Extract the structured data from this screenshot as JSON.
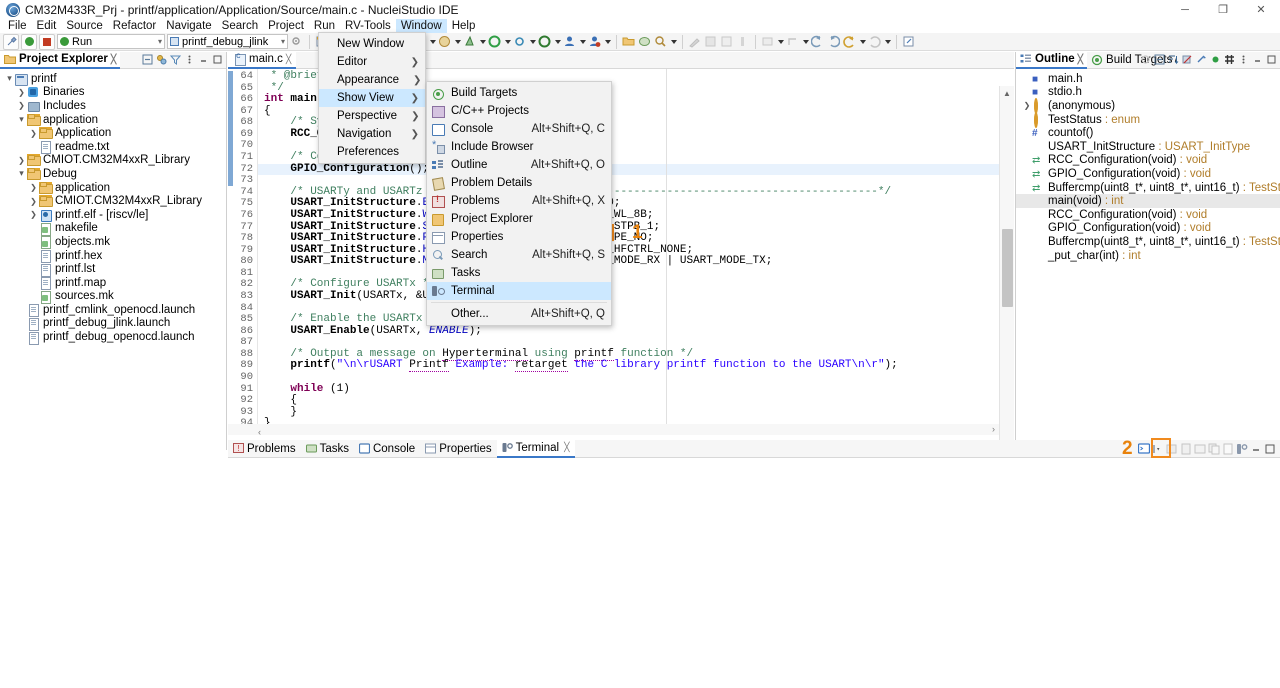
{
  "window": {
    "title": "CM32M433R_Prj - printf/application/Application/Source/main.c - NucleiStudio IDE",
    "minimize": "─",
    "maximize": "❐",
    "close": "✕"
  },
  "menubar": {
    "items": [
      {
        "label": "File"
      },
      {
        "label": "Edit"
      },
      {
        "label": "Source"
      },
      {
        "label": "Refactor"
      },
      {
        "label": "Navigate"
      },
      {
        "label": "Search"
      },
      {
        "label": "Project"
      },
      {
        "label": "Run"
      },
      {
        "label": "RV-Tools"
      },
      {
        "label": "Window",
        "active": true
      },
      {
        "label": "Help"
      }
    ]
  },
  "toolbar": {
    "run_config": "Run",
    "launch_config": "printf_debug_jlink"
  },
  "window_menu": {
    "items": [
      {
        "label": "New Window",
        "submenu": false
      },
      {
        "label": "Editor",
        "submenu": true
      },
      {
        "label": "Appearance",
        "submenu": true
      },
      {
        "label": "Show View",
        "submenu": true,
        "selected": true
      },
      {
        "label": "Perspective",
        "submenu": true
      },
      {
        "label": "Navigation",
        "submenu": true
      },
      {
        "label": "Preferences",
        "submenu": false
      }
    ]
  },
  "show_view_menu": {
    "items": [
      {
        "label": "Build Targets",
        "accel": "",
        "icon": "radio-icon"
      },
      {
        "label": "C/C++ Projects",
        "accel": "",
        "icon": "grid-icon"
      },
      {
        "label": "Console",
        "accel": "Alt+Shift+Q, C",
        "icon": "console-icon"
      },
      {
        "label": "Include Browser",
        "accel": "",
        "icon": "include-browser-icon"
      },
      {
        "label": "Outline",
        "accel": "Alt+Shift+Q, O",
        "icon": "outline-icon"
      },
      {
        "label": "Problem Details",
        "accel": "",
        "icon": "problem-details-icon"
      },
      {
        "label": "Problems",
        "accel": "Alt+Shift+Q, X",
        "icon": "problems-icon"
      },
      {
        "label": "Project Explorer",
        "accel": "",
        "icon": "project-explorer-icon"
      },
      {
        "label": "Properties",
        "accel": "",
        "icon": "properties-icon"
      },
      {
        "label": "Search",
        "accel": "Alt+Shift+Q, S",
        "icon": "search-icon"
      },
      {
        "label": "Tasks",
        "accel": "",
        "icon": "tasks-icon"
      },
      {
        "label": "Terminal",
        "accel": "",
        "icon": "terminal-icon",
        "selected": true,
        "highlighted": true
      },
      {
        "label": "Other...",
        "accel": "Alt+Shift+Q, Q",
        "icon": "",
        "divider_before": true
      }
    ]
  },
  "annotations": [
    {
      "number": "1"
    },
    {
      "number": "2"
    }
  ],
  "project_explorer": {
    "tab_label": "Project Explorer",
    "tree": [
      {
        "indent": 0,
        "arrow": "v",
        "icon": "project-icon",
        "label": "printf"
      },
      {
        "indent": 1,
        "arrow": ">",
        "icon": "binaries-icon",
        "label": "Binaries"
      },
      {
        "indent": 1,
        "arrow": ">",
        "icon": "includes-icon",
        "label": "Includes"
      },
      {
        "indent": 1,
        "arrow": "v",
        "icon": "folder-icon",
        "label": "application"
      },
      {
        "indent": 2,
        "arrow": ">",
        "icon": "folder-icon",
        "label": "Application"
      },
      {
        "indent": 2,
        "arrow": "",
        "icon": "file-icon",
        "label": "readme.txt"
      },
      {
        "indent": 1,
        "arrow": ">",
        "icon": "folder-icon",
        "label": "CMIOT.CM32M4xxR_Library"
      },
      {
        "indent": 1,
        "arrow": "v",
        "icon": "folder-icon",
        "label": "Debug"
      },
      {
        "indent": 2,
        "arrow": ">",
        "icon": "folder-icon",
        "label": "application"
      },
      {
        "indent": 2,
        "arrow": ">",
        "icon": "folder-icon",
        "label": "CMIOT.CM32M4xxR_Library"
      },
      {
        "indent": 2,
        "arrow": ">",
        "icon": "elf-icon",
        "label": "printf.elf - [riscv/le]"
      },
      {
        "indent": 2,
        "arrow": "",
        "icon": "makefile-icon",
        "label": "makefile"
      },
      {
        "indent": 2,
        "arrow": "",
        "icon": "makefile-icon",
        "label": "objects.mk"
      },
      {
        "indent": 2,
        "arrow": "",
        "icon": "file-icon",
        "label": "printf.hex"
      },
      {
        "indent": 2,
        "arrow": "",
        "icon": "file-icon",
        "label": "printf.lst"
      },
      {
        "indent": 2,
        "arrow": "",
        "icon": "file-icon",
        "label": "printf.map"
      },
      {
        "indent": 2,
        "arrow": "",
        "icon": "makefile-icon",
        "label": "sources.mk"
      },
      {
        "indent": 1,
        "arrow": "",
        "icon": "file-icon",
        "label": "printf_cmlink_openocd.launch"
      },
      {
        "indent": 1,
        "arrow": "",
        "icon": "file-icon",
        "label": "printf_debug_jlink.launch"
      },
      {
        "indent": 1,
        "arrow": "",
        "icon": "file-icon",
        "label": "printf_debug_openocd.launch"
      }
    ]
  },
  "editor": {
    "tab_label": "main.c",
    "first_line": 64,
    "lines": [
      {
        "n": 64,
        "html": "<span class='cmt'> * @brief Main program.</span>"
      },
      {
        "n": 65,
        "html": "<span class='cmt'> */</span>"
      },
      {
        "n": 66,
        "html": "<span class='kw'>int</span> <span style='font-weight:bold'>main</span>(<span class='kw'>void</span>)",
        "fold": true
      },
      {
        "n": 67,
        "html": "{"
      },
      {
        "n": 68,
        "html": "    <span class='cmt'>/* System Clocks Configuration */</span>"
      },
      {
        "n": 69,
        "html": "    <span style='font-weight:bold'>RCC_Configuration</span>();"
      },
      {
        "n": 70,
        "html": ""
      },
      {
        "n": 71,
        "html": "    <span class='cmt'>/* Configure the GPIO ports */</span>"
      },
      {
        "n": 72,
        "html": "    <span style='font-weight:bold'>GPIO_Configuration</span>();",
        "hl": true
      },
      {
        "n": 73,
        "html": ""
      },
      {
        "n": 74,
        "html": "    <span class='cmt'>/* USARTy and USARTz configuration ------------------------------------------------------*/</span>"
      },
      {
        "n": 75,
        "html": "    <span style='font-weight:bold'>USART_InitStructure</span>.<span class='fld'>BaudRate</span>             = 115200;"
      },
      {
        "n": 76,
        "html": "    <span style='font-weight:bold'>USART_InitStructure</span>.<span class='fld'>WordLength</span>           = USART_WL_8B;"
      },
      {
        "n": 77,
        "html": "    <span style='font-weight:bold'>USART_InitStructure</span>.<span class='fld'>StopBits</span>             = USART_STPB_1;"
      },
      {
        "n": 78,
        "html": "    <span style='font-weight:bold'>USART_InitStructure</span>.<span class='fld'>Parity</span>               = USART_PE_NO;"
      },
      {
        "n": 79,
        "html": "    <span style='font-weight:bold'>USART_InitStructure</span>.<span class='fld'>HardwareFlowControl</span>  = USART_HFCTRL_NONE;"
      },
      {
        "n": 80,
        "html": "    <span style='font-weight:bold'>USART_InitStructure</span>.<span class='fld'>Mode</span>                 = USART_MODE_RX | USART_MODE_TX;"
      },
      {
        "n": 81,
        "html": ""
      },
      {
        "n": 82,
        "html": "    <span class='cmt'>/* Configure USARTx */</span>"
      },
      {
        "n": 83,
        "html": "    <span style='font-weight:bold'>USART_Init</span>(USARTx, &amp;USART_InitStructure);"
      },
      {
        "n": 84,
        "html": ""
      },
      {
        "n": 85,
        "html": "    <span class='cmt'>/* Enable the USARTx */</span>"
      },
      {
        "n": 86,
        "html": "    <span style='font-weight:bold'>USART_Enable</span>(USARTx, <span class='ital'>ENABLE</span>);"
      },
      {
        "n": 87,
        "html": ""
      },
      {
        "n": 88,
        "html": "    <span class='cmt'>/* Output a message on <span class='underline-purple'>Hyperterminal</span> using <span class='underline-purple'>printf</span> function */</span>"
      },
      {
        "n": 89,
        "html": "    <span style='font-weight:bold'>printf</span>(<span class='str'>\"\\n\\rUSART <span class='underline-purple'>Printf</span> Example: <span class='underline-purple'>retarget</span> the C library printf function to the USART\\n\\r\"</span>);"
      },
      {
        "n": 90,
        "html": ""
      },
      {
        "n": 91,
        "html": "    <span class='kw'>while</span> (1)"
      },
      {
        "n": 92,
        "html": "    {"
      },
      {
        "n": 93,
        "html": "    }"
      },
      {
        "n": 94,
        "html": "}"
      }
    ]
  },
  "outline": {
    "tabs": [
      {
        "label": "Outline",
        "selected": true
      },
      {
        "label": "Build Targets",
        "selected": false
      }
    ],
    "items": [
      {
        "arrow": "",
        "icon": "header-icon",
        "label": "main.h",
        "type": ""
      },
      {
        "arrow": "",
        "icon": "header-icon",
        "label": "stdio.h",
        "type": ""
      },
      {
        "arrow": ">",
        "icon": "ring-icon",
        "label": "(anonymous)",
        "type": ""
      },
      {
        "arrow": "",
        "icon": "ring-icon",
        "label": "TestStatus",
        "type": " : enum"
      },
      {
        "arrow": "",
        "icon": "hash-icon",
        "label": "countof()",
        "type": ""
      },
      {
        "arrow": "",
        "icon": "dot-blue-icon",
        "label": "USART_InitStructure",
        "type": " : USART_InitType"
      },
      {
        "arrow": "",
        "icon": "proto-icon",
        "label": "RCC_Configuration(void)",
        "type": " : void"
      },
      {
        "arrow": "",
        "icon": "proto-icon",
        "label": "GPIO_Configuration(void)",
        "type": " : void"
      },
      {
        "arrow": "",
        "icon": "proto-icon",
        "label": "Buffercmp(uint8_t*, uint8_t*, uint16_t)",
        "type": " : TestStatus"
      },
      {
        "arrow": "",
        "icon": "dot-icon",
        "label": "main(void)",
        "type": " : int",
        "selected": true
      },
      {
        "arrow": "",
        "icon": "dot-icon",
        "label": "RCC_Configuration(void)",
        "type": " : void"
      },
      {
        "arrow": "",
        "icon": "dot-icon",
        "label": "GPIO_Configuration(void)",
        "type": " : void"
      },
      {
        "arrow": "",
        "icon": "dot-icon",
        "label": "Buffercmp(uint8_t*, uint8_t*, uint16_t)",
        "type": " : TestStatus"
      },
      {
        "arrow": "",
        "icon": "dot-icon",
        "label": "_put_char(int)",
        "type": " : int"
      }
    ]
  },
  "bottom_panel": {
    "tabs": [
      {
        "label": "Problems",
        "icon": "problems-icon",
        "selected": false
      },
      {
        "label": "Tasks",
        "icon": "tasks-icon",
        "selected": false
      },
      {
        "label": "Console",
        "icon": "console-icon",
        "selected": false
      },
      {
        "label": "Properties",
        "icon": "properties-icon",
        "selected": false
      },
      {
        "label": "Terminal",
        "icon": "terminal-icon",
        "selected": true
      }
    ]
  },
  "colors": {
    "accent_highlight": "#f08a1e",
    "selection_blue": "#cce8ff",
    "tab_underline": "#3a78c8"
  }
}
